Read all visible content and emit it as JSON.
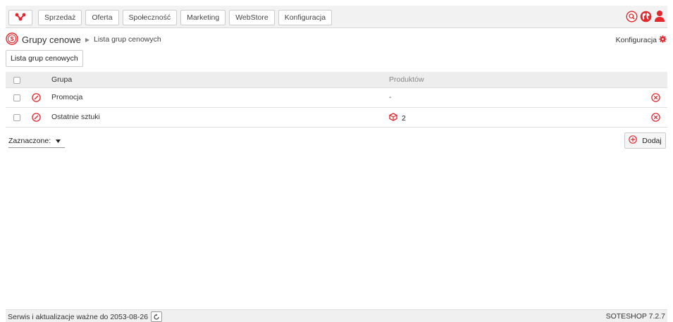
{
  "topbar": {
    "logo_icon": "soteshop-logo-icon",
    "nav": [
      "Sprzedaż",
      "Oferta",
      "Społeczność",
      "Marketing",
      "WebStore",
      "Konfiguracja"
    ],
    "icons": [
      "search-icon",
      "globe-icon",
      "user-icon"
    ],
    "accent": "#e3272d"
  },
  "breadcrumb": {
    "module_icon": "price-group-icon",
    "title": "Grupy cenowe",
    "current": "Lista grup cenowych"
  },
  "config_link": "Konfiguracja",
  "tab_button": "Lista grup cenowych",
  "table": {
    "columns": [
      "Grupa",
      "Produktów"
    ],
    "rows": [
      {
        "name": "Promocja",
        "products": "-",
        "has_icon": false
      },
      {
        "name": "Ostatnie sztuki",
        "products": "2",
        "has_icon": true
      }
    ]
  },
  "bulk_select": "Zaznaczone:",
  "add_button": "Dodaj",
  "footer": {
    "service_text": "Serwis i aktualizacje ważne do 2053-08-26",
    "version": "SOTESHOP 7.2.7"
  }
}
